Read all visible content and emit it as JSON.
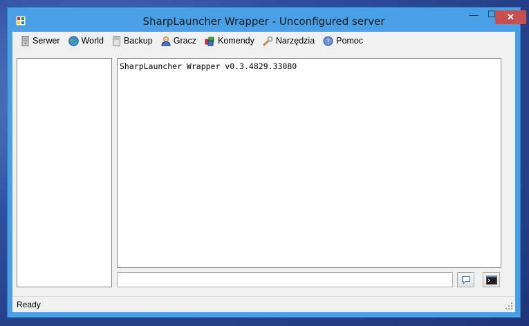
{
  "window": {
    "title": "SharpLauncher Wrapper - Unconfigured server",
    "minimize_glyph": "—",
    "maximize_glyph": "☐",
    "close_glyph": "✕"
  },
  "menu": [
    {
      "label": "Serwer",
      "icon": "server-icon"
    },
    {
      "label": "World",
      "icon": "globe-icon"
    },
    {
      "label": "Backup",
      "icon": "backup-icon"
    },
    {
      "label": "Gracz",
      "icon": "user-icon"
    },
    {
      "label": "Komendy",
      "icon": "commands-icon"
    },
    {
      "label": "Narzędzia",
      "icon": "wrench-icon"
    },
    {
      "label": "Pomoc",
      "icon": "help-icon"
    }
  ],
  "console": {
    "lines": [
      "SharpLauncher Wrapper v0.3.4829.33080"
    ]
  },
  "command": {
    "value": "",
    "placeholder": ""
  },
  "status": {
    "text": "Ready"
  },
  "colors": {
    "window_frame": "#4aa0e6",
    "close_button": "#c74f4f",
    "client_bg": "#f0f0f0"
  }
}
